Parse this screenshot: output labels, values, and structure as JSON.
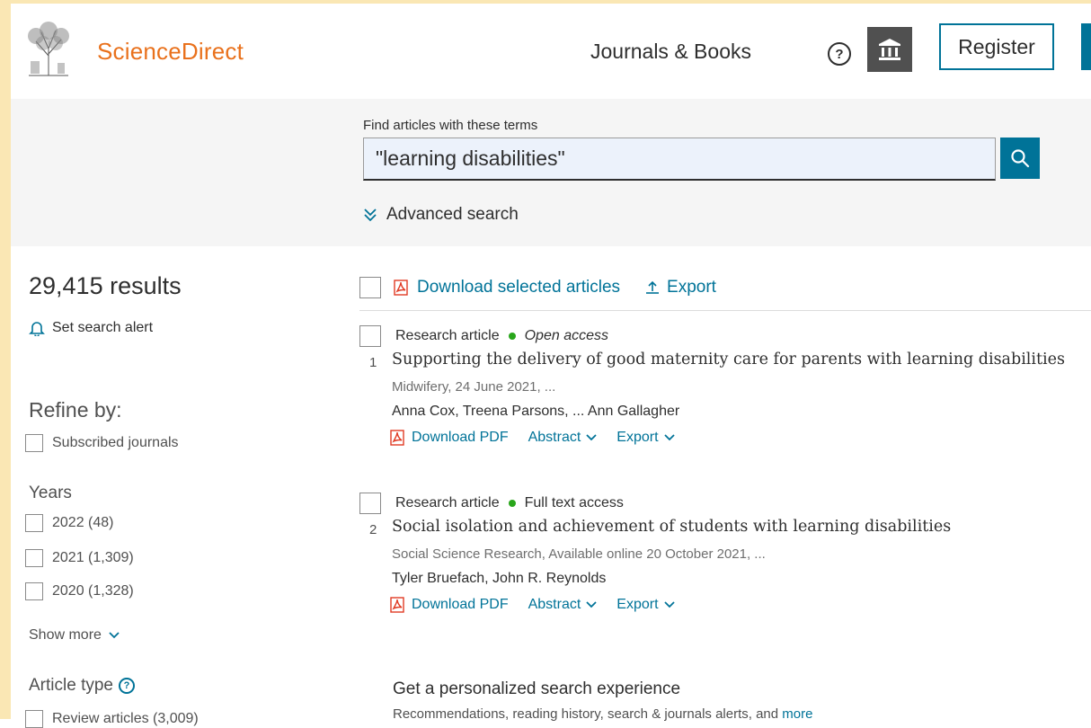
{
  "header": {
    "brand": "ScienceDirect",
    "nav_journals": "Journals & Books",
    "help_glyph": "?",
    "register_label": "Register",
    "accent_color": "#007398",
    "brand_color": "#e9711c"
  },
  "search": {
    "label": "Find articles with these terms",
    "query": "\"learning disabilities\"",
    "advanced_label": "Advanced search"
  },
  "sidebar": {
    "results_count": "29,415 results",
    "alert_label": "Set search alert",
    "refine_title": "Refine by:",
    "subscribed_label": "Subscribed journals",
    "years_title": "Years",
    "years": [
      {
        "label": "2022 (48)"
      },
      {
        "label": "2021 (1,309)"
      },
      {
        "label": "2020 (1,328)"
      }
    ],
    "show_more": "Show more",
    "article_type_title": "Article type",
    "article_type_partial": "Review articles (3,009)"
  },
  "toolbar": {
    "download_label": "Download selected articles",
    "export_label": "Export"
  },
  "results": [
    {
      "type": "Research article",
      "access": "Open access",
      "number": "1",
      "title": "Supporting the delivery of good maternity care for parents with learning disabilities",
      "source": "Midwifery, 24 June 2021, ...",
      "authors": "Anna Cox, Treena Parsons, ... Ann Gallagher",
      "pdf_label": "Download PDF",
      "abstract_label": "Abstract",
      "export_label": "Export"
    },
    {
      "type": "Research article",
      "access": "Full text access",
      "number": "2",
      "title": "Social isolation and achievement of students with learning disabilities",
      "source": "Social Science Research, Available online 20 October 2021, ...",
      "authors": "Tyler Bruefach, John R. Reynolds",
      "pdf_label": "Download PDF",
      "abstract_label": "Abstract",
      "export_label": "Export"
    }
  ],
  "promo": {
    "title": "Get a personalized search experience",
    "subtitle": "Recommendations, reading history, search & journals alerts, and",
    "more": "more"
  }
}
